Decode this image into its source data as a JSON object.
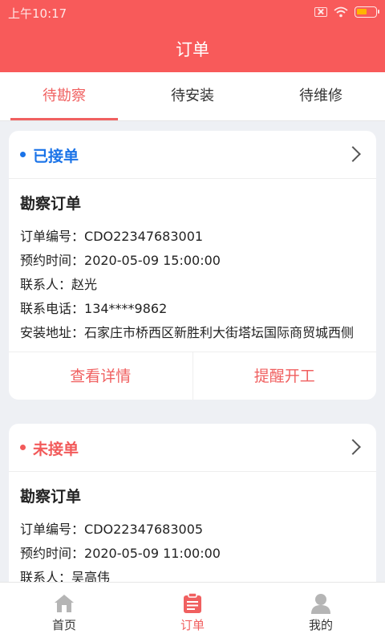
{
  "status_bar": {
    "time": "上午10:17"
  },
  "header": {
    "title": "订单"
  },
  "tabs": [
    {
      "label": "待勘察",
      "active": true
    },
    {
      "label": "待安装",
      "active": false
    },
    {
      "label": "待维修",
      "active": false
    }
  ],
  "cards": [
    {
      "status": "已接单",
      "status_color": "#1a73e8",
      "type": "勘察订单",
      "fields": {
        "order_no_label": "订单编号：",
        "order_no": "CDO22347683001",
        "time_label": "预约时间：",
        "time": "2020-05-09 15:00:00",
        "contact_label": "联系人：",
        "contact": "赵光",
        "phone_label": "联系电话：",
        "phone": "134****9862",
        "address_label": "安装地址：",
        "address": "石家庄市桥西区新胜利大街塔坛国际商贸城西侧"
      },
      "actions": [
        "查看详情",
        "提醒开工"
      ]
    },
    {
      "status": "未接单",
      "status_color": "#f25a5a",
      "type": "勘察订单",
      "fields": {
        "order_no_label": "订单编号：",
        "order_no": "CDO22347683005",
        "time_label": "预约时间：",
        "time": "2020-05-09 11:00:00",
        "contact_label": "联系人：",
        "contact": "吴高伟"
      }
    }
  ],
  "bottom_nav": [
    {
      "label": "首页",
      "icon": "home-icon",
      "active": false
    },
    {
      "label": "订单",
      "icon": "order-icon",
      "active": true
    },
    {
      "label": "我的",
      "icon": "user-icon",
      "active": false
    }
  ],
  "colors": {
    "brand": "#f85a5a",
    "accent": "#f06060",
    "accepted": "#1a73e8",
    "pending": "#f25a5a"
  }
}
